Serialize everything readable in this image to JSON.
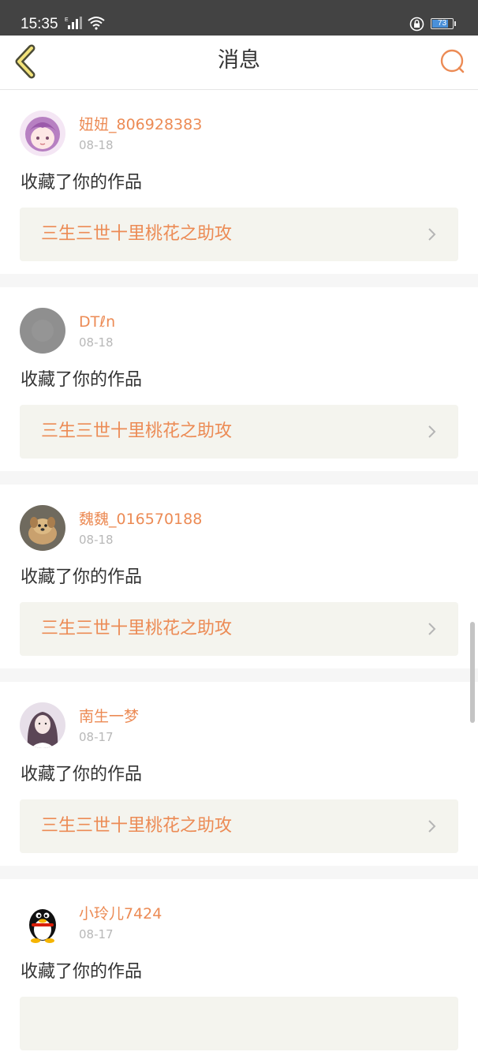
{
  "status_bar": {
    "time": "15:35",
    "battery": "73",
    "battery_level": 0.73,
    "icons": [
      "signal-icon",
      "wifi-icon",
      "rotation-lock-icon",
      "battery-icon"
    ]
  },
  "nav": {
    "title": "消息",
    "back_icon": "chevron-left-icon",
    "search_icon": "search-icon",
    "accent": "#ec8b55"
  },
  "colors": {
    "accent": "#ec8b55",
    "text": "#333333",
    "muted": "#b8b8b8",
    "link_bg": "#f4f4ee",
    "divider": "#f6f6f6"
  },
  "messages": [
    {
      "username": "妞妞_806928383",
      "date": "08-18",
      "action": "收藏了你的作品",
      "work": "三生三世十里桃花之助攻",
      "avatar": "anime-girl-avatar"
    },
    {
      "username": "DTℓn",
      "date": "08-18",
      "action": "收藏了你的作品",
      "work": "三生三世十里桃花之助攻",
      "avatar": "gray-avatar"
    },
    {
      "username": "魏魏_016570188",
      "date": "08-18",
      "action": "收藏了你的作品",
      "work": "三生三世十里桃花之助攻",
      "avatar": "puppy-avatar"
    },
    {
      "username": "南生一梦",
      "date": "08-17",
      "action": "收藏了你的作品",
      "work": "三生三世十里桃花之助攻",
      "avatar": "girl-photo-avatar"
    },
    {
      "username": "小玲儿7424",
      "date": "08-17",
      "action": "收藏了你的作品",
      "work": "",
      "avatar": "qq-penguin-avatar"
    }
  ]
}
